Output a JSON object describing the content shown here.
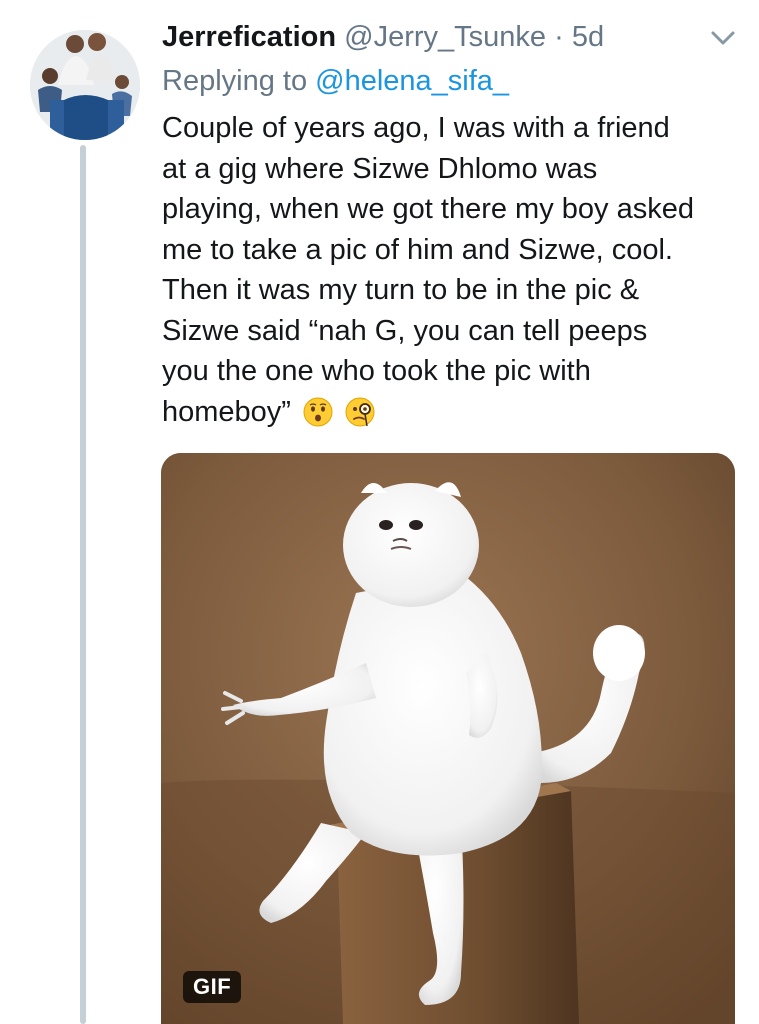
{
  "tweet": {
    "display_name": "Jerrefication",
    "handle": "@Jerry_Tsunke",
    "separator": "·",
    "time": "5d",
    "replying_prefix": "Replying to",
    "replying_to": "@helena_sifa_",
    "text_lines": [
      "Couple of years ago, I was with a friend",
      "at a gig where Sizwe Dhlomo was",
      "playing, when we got there my boy asked",
      "me to take a pic of him and Sizwe, cool.",
      "Then it was my turn to be in the pic &",
      "Sizwe said “nah G, you can tell peeps",
      "you the one who took the pic with",
      "homeboy”"
    ],
    "emojis": [
      "hushed-face-emoji",
      "face-with-monocle-emoji"
    ]
  },
  "media": {
    "badge": "GIF",
    "icon": "persian-cat-statue-gif"
  },
  "colors": {
    "link": "#1b95e0",
    "muted": "#657786",
    "thread_line": "#c4cfd6",
    "text": "#14171a"
  }
}
